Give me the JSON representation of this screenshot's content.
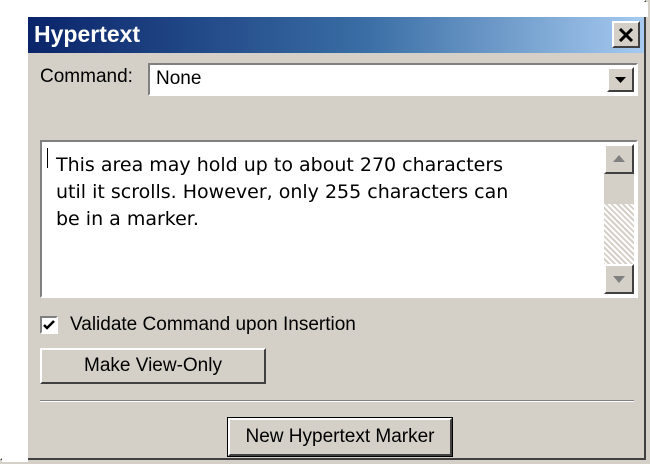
{
  "window": {
    "title": "Hypertext"
  },
  "command": {
    "label": "Command:",
    "selected": "None"
  },
  "text_area": {
    "content": "This area may hold up to about 270 characters\nutil it scrolls. However, only 255 characters can\nbe in a marker."
  },
  "validate": {
    "label": "Validate Command upon Insertion",
    "checked": true
  },
  "buttons": {
    "make_view_only": "Make View-Only",
    "new_marker": "New Hypertext Marker"
  },
  "colors": {
    "titlebar_start": "#0a246a",
    "titlebar_end": "#a6caf0",
    "face": "#d4d0c8"
  }
}
